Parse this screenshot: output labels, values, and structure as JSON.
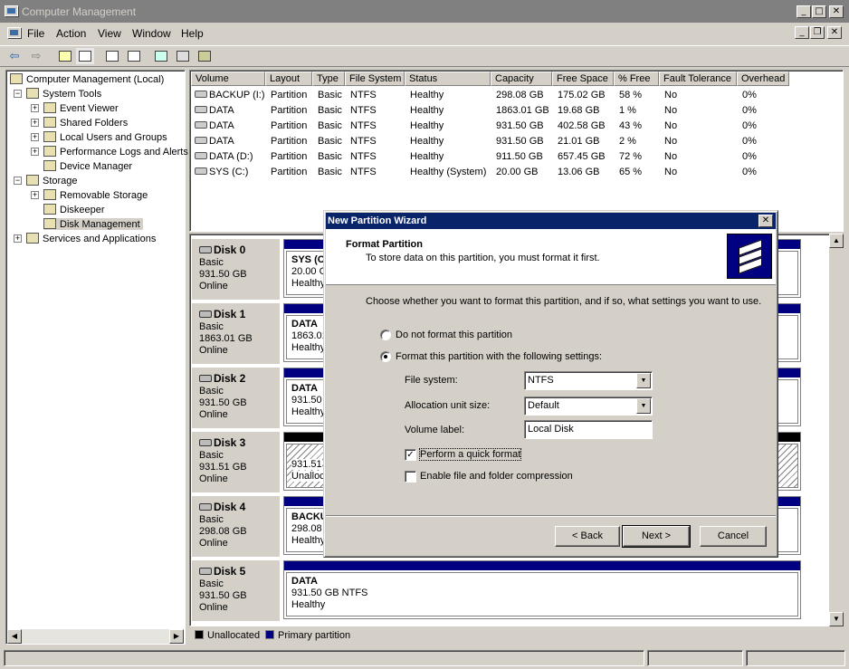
{
  "window": {
    "title": "Computer Management",
    "minimize": "_",
    "maximize": "□",
    "close": "✕"
  },
  "menu": {
    "file": "File",
    "action": "Action",
    "view": "View",
    "window": "Window",
    "help": "Help"
  },
  "tree": {
    "root": "Computer Management (Local)",
    "system_tools": "System Tools",
    "event_viewer": "Event Viewer",
    "shared_folders": "Shared Folders",
    "local_users": "Local Users and Groups",
    "perf_logs": "Performance Logs and Alerts",
    "device_manager": "Device Manager",
    "storage": "Storage",
    "removable_storage": "Removable Storage",
    "diskeeper": "Diskeeper",
    "disk_management": "Disk Management",
    "services": "Services and Applications"
  },
  "volumes": {
    "headers": [
      "Volume",
      "Layout",
      "Type",
      "File System",
      "Status",
      "Capacity",
      "Free Space",
      "% Free",
      "Fault Tolerance",
      "Overhead"
    ],
    "rows": [
      [
        "BACKUP (I:)",
        "Partition",
        "Basic",
        "NTFS",
        "Healthy",
        "298.08 GB",
        "175.02 GB",
        "58 %",
        "No",
        "0%"
      ],
      [
        "DATA",
        "Partition",
        "Basic",
        "NTFS",
        "Healthy",
        "1863.01 GB",
        "19.68 GB",
        "1 %",
        "No",
        "0%"
      ],
      [
        "DATA",
        "Partition",
        "Basic",
        "NTFS",
        "Healthy",
        "931.50 GB",
        "402.58 GB",
        "43 %",
        "No",
        "0%"
      ],
      [
        "DATA",
        "Partition",
        "Basic",
        "NTFS",
        "Healthy",
        "931.50 GB",
        "21.01 GB",
        "2 %",
        "No",
        "0%"
      ],
      [
        "DATA (D:)",
        "Partition",
        "Basic",
        "NTFS",
        "Healthy",
        "911.50 GB",
        "657.45 GB",
        "72 %",
        "No",
        "0%"
      ],
      [
        "SYS (C:)",
        "Partition",
        "Basic",
        "NTFS",
        "Healthy (System)",
        "20.00 GB",
        "13.06 GB",
        "65 %",
        "No",
        "0%"
      ]
    ]
  },
  "disks": [
    {
      "name": "Disk 0",
      "type": "Basic",
      "size": "931.50 GB",
      "state": "Online",
      "part_title": "SYS (C",
      "part_size": "20.00 G",
      "part_status": "Healthy"
    },
    {
      "name": "Disk 1",
      "type": "Basic",
      "size": "1863.01 GB",
      "state": "Online",
      "part_title": "DATA",
      "part_size": "1863.01",
      "part_status": "Healthy"
    },
    {
      "name": "Disk 2",
      "type": "Basic",
      "size": "931.50 GB",
      "state": "Online",
      "part_title": "DATA",
      "part_size": "931.50",
      "part_status": "Healthy"
    },
    {
      "name": "Disk 3",
      "type": "Basic",
      "size": "931.51 GB",
      "state": "Online",
      "part_title": "",
      "part_size": "931.51",
      "part_status": "Unalloca"
    },
    {
      "name": "Disk 4",
      "type": "Basic",
      "size": "298.08 GB",
      "state": "Online",
      "part_title": "BACKU",
      "part_size": "298.08",
      "part_status": "Healthy"
    },
    {
      "name": "Disk 5",
      "type": "Basic",
      "size": "931.50 GB",
      "state": "Online",
      "part_title": "DATA",
      "part_size": "931.50 GB NTFS",
      "part_status": "Healthy"
    }
  ],
  "legend": {
    "unallocated": "Unallocated",
    "primary": "Primary partition"
  },
  "dialog": {
    "title": "New Partition Wizard",
    "close": "✕",
    "heading": "Format Partition",
    "subheading": "To store data on this partition, you must format it first.",
    "instruction": "Choose whether you want to format this partition, and if so, what settings you want to use.",
    "opt_no_format": "Do not format this partition",
    "opt_format": "Format this partition with the following settings:",
    "fs_label": "File system:",
    "fs_value": "NTFS",
    "alloc_label": "Allocation unit size:",
    "alloc_value": "Default",
    "vol_label": "Volume label:",
    "vol_value": "Local Disk",
    "quick_format": "Perform a quick format",
    "compression": "Enable file and folder compression",
    "back": "< Back",
    "next": "Next >",
    "cancel": "Cancel"
  },
  "colors": {
    "primary_partition": "#000080",
    "unallocated": "#000000",
    "title_active": "#0a246a",
    "title_inactive": "#808080"
  }
}
